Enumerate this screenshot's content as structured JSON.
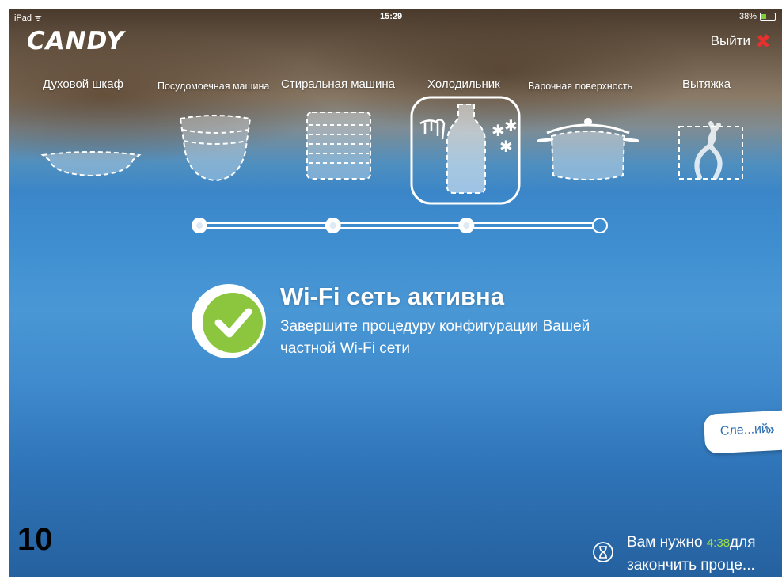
{
  "status_bar": {
    "device": "iPad",
    "time": "15:29",
    "battery": "38%"
  },
  "header": {
    "logo_text": "CANDY",
    "logout_label": "Выйти"
  },
  "categories": [
    {
      "label": "Духовой шкаф",
      "icon": "baking-dish-icon",
      "selected": false
    },
    {
      "label": "Посудомоечная машина",
      "icon": "bowls-stack-icon",
      "selected": false
    },
    {
      "label": "Стиральная машина",
      "icon": "plates-stack-icon",
      "selected": false
    },
    {
      "label": "Холодильник",
      "icon": "milk-bottle-icon",
      "selected": true
    },
    {
      "label": "Варочная поверхность",
      "icon": "cooking-pot-icon",
      "selected": false
    },
    {
      "label": "Вытяжка",
      "icon": "steam-icon",
      "selected": false
    }
  ],
  "progress": {
    "steps_total": 4,
    "steps_completed": 3
  },
  "message": {
    "title": "Wi-Fi сеть активна",
    "subtitle_line1": "Завершите процедуру конфигурации Вашей",
    "subtitle_line2": "частной Wi-Fi сети"
  },
  "next_button": {
    "label": "Сле...ий",
    "arrows": "»"
  },
  "step_number": "10",
  "timer": {
    "prefix": "Вам нужно",
    "value": "4:38",
    "suffix": "для",
    "line2": "закончить проце..."
  },
  "colors": {
    "accent_green": "#8cc63f",
    "timer_green": "#9fe04a",
    "logout_red": "#e8312f",
    "button_text_blue": "#2a6fb3"
  }
}
